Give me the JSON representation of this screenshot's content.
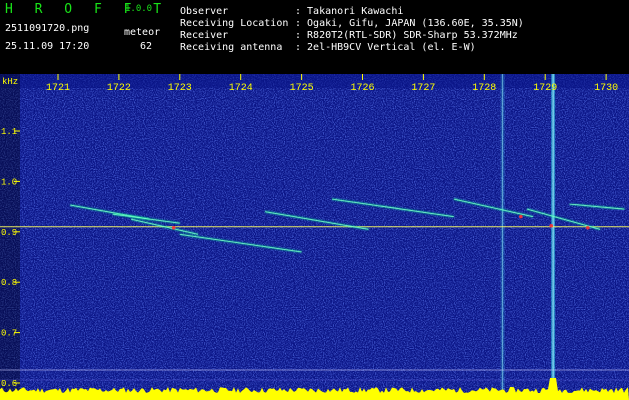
{
  "app": {
    "brand": "H R O F F T",
    "version": "1.0.0",
    "filename": "2511091720.png",
    "datetime": "25.11.09 17:20",
    "meteor_label": "meteor",
    "meteor_count": "62"
  },
  "info": {
    "observer_label": "Observer",
    "observer_value": ": Takanori Kawachi",
    "location_label": "Receiving Location",
    "location_value": ": Ogaki, Gifu, JAPAN (136.60E, 35.35N)",
    "receiver_label": "Receiver",
    "receiver_value": ": R820T2(RTL-SDR) SDR-Sharp 53.372MHz",
    "antenna_label": "Receiving antenna",
    "antenna_value": ": 2el-HB9CV Vertical (el. E-W)"
  },
  "colors": {
    "brand": "#19e319",
    "text": "#ffffff",
    "tick": "#ffff00",
    "background": "#0a1486",
    "signal": "#00ff90",
    "hot": "#ff3030",
    "bottom_band": "#ffff00"
  },
  "chart_data": {
    "type": "heatmap",
    "ylabel": "kHz",
    "x_ticks": [
      "1721",
      "1722",
      "1723",
      "1724",
      "1725",
      "1726",
      "1727",
      "1728",
      "1729",
      "1730"
    ],
    "y_ticks": [
      "1.1",
      "1.0",
      "0.9",
      "0.8",
      "0.7",
      "0.6"
    ],
    "ylim": [
      0.58,
      1.19
    ],
    "xlim": [
      1720.6,
      1730.5
    ],
    "carrier_freq_khz": 0.91,
    "meteor_echoes": [
      {
        "t_start": 1721.2,
        "t_end": 1722.5,
        "f_start": 0.953,
        "f_end": 0.925
      },
      {
        "t_start": 1721.9,
        "t_end": 1723.0,
        "f_start": 0.935,
        "f_end": 0.917
      },
      {
        "t_start": 1722.2,
        "t_end": 1723.3,
        "f_start": 0.925,
        "f_end": 0.895
      },
      {
        "t_start": 1723.0,
        "t_end": 1725.0,
        "f_start": 0.895,
        "f_end": 0.86
      },
      {
        "t_start": 1724.4,
        "t_end": 1726.1,
        "f_start": 0.94,
        "f_end": 0.905
      },
      {
        "t_start": 1725.5,
        "t_end": 1727.5,
        "f_start": 0.965,
        "f_end": 0.93
      },
      {
        "t_start": 1727.5,
        "t_end": 1728.8,
        "f_start": 0.965,
        "f_end": 0.93
      },
      {
        "t_start": 1728.7,
        "t_end": 1729.9,
        "f_start": 0.945,
        "f_end": 0.905
      },
      {
        "t_start": 1729.4,
        "t_end": 1730.3,
        "f_start": 0.955,
        "f_end": 0.945
      }
    ],
    "vertical_bursts": [
      1728.3,
      1729.13
    ]
  }
}
